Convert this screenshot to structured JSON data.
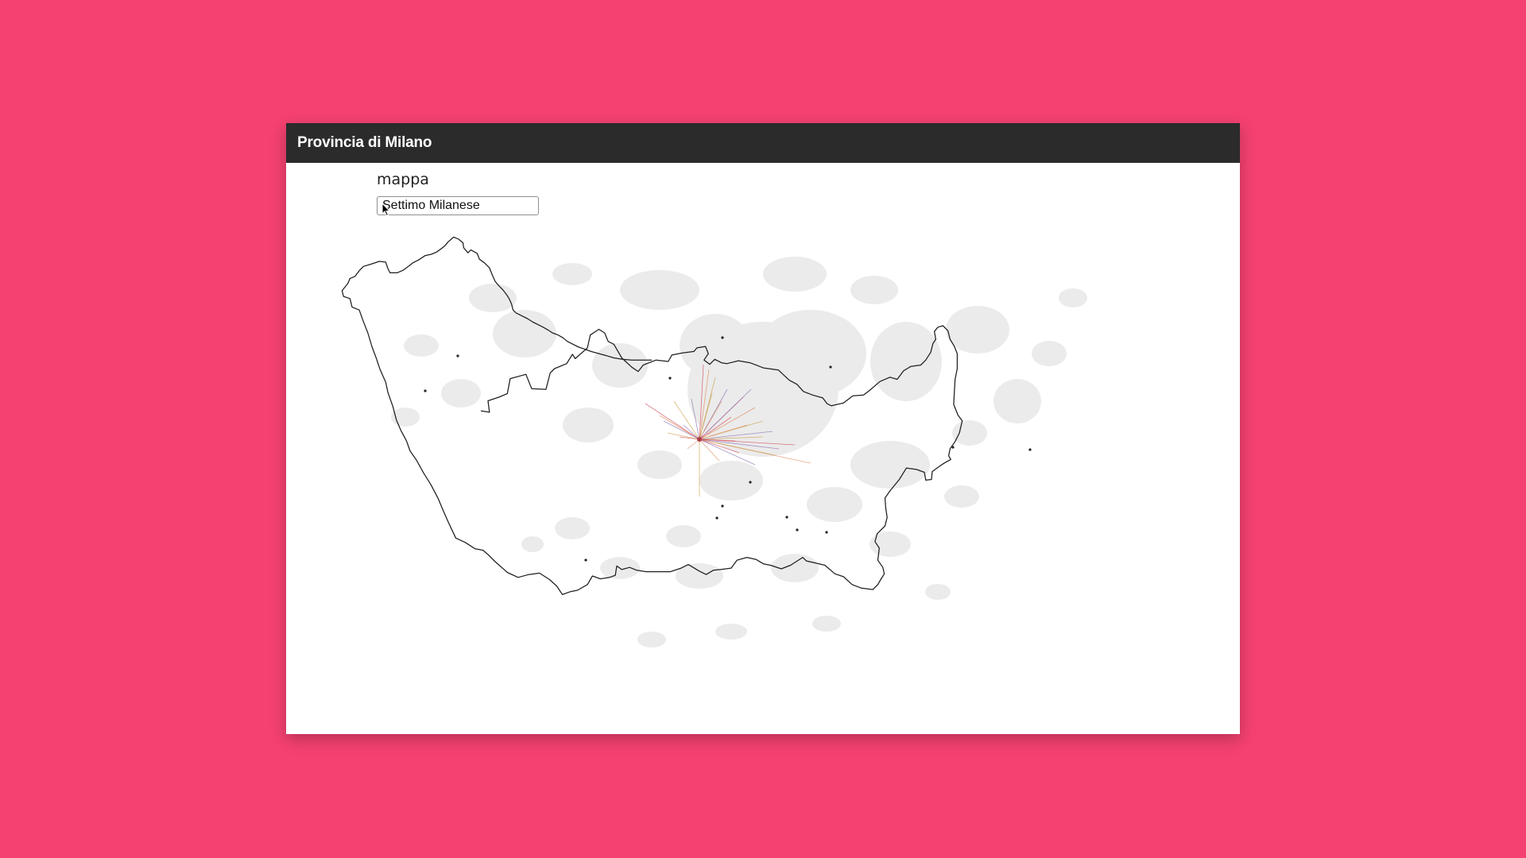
{
  "window": {
    "title": "Provincia di Milano"
  },
  "section": {
    "heading": "mappa"
  },
  "search": {
    "value": "Settimo Milanese"
  },
  "map": {
    "selected_town": "Settimo Milanese",
    "flow_colors": [
      "#d64a5e",
      "#e08a5a",
      "#c9a04a",
      "#8a6fb0"
    ]
  }
}
